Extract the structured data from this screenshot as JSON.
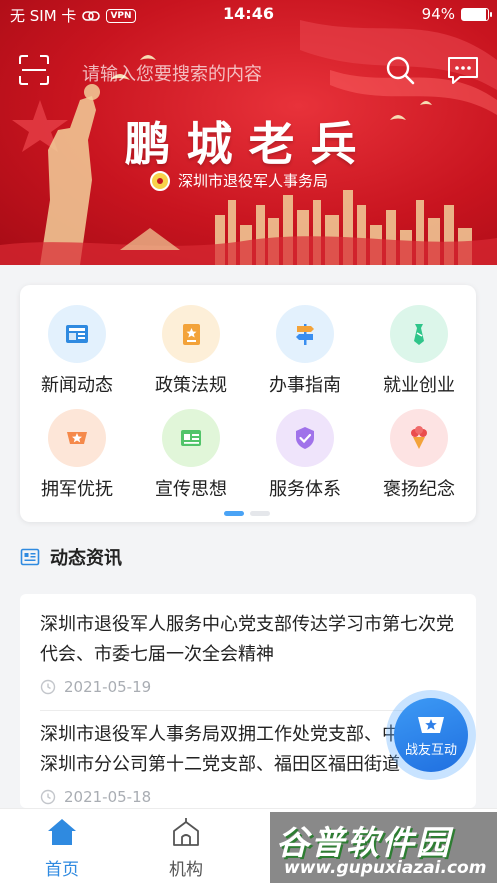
{
  "status_bar": {
    "carrier": "无 SIM 卡",
    "vpn": "VPN",
    "time": "14:46",
    "battery": "94%",
    "battery_level": 0.94
  },
  "header": {
    "search_placeholder": "请输入您要搜索的内容",
    "icons": [
      "scan-icon",
      "search-icon",
      "message-icon"
    ]
  },
  "banner": {
    "title": "鹏城老兵",
    "subtitle": "深圳市退役军人事务局"
  },
  "menu": {
    "items": [
      {
        "label": "新闻动态",
        "icon": "newspaper-icon",
        "bg": "#e3f1fd",
        "color": "#2f8ae0"
      },
      {
        "label": "政策法规",
        "icon": "policy-book-icon",
        "bg": "#fdefd8",
        "color": "#f3a33a"
      },
      {
        "label": "办事指南",
        "icon": "signpost-icon",
        "bg": "#e3f1fd",
        "color": "#3a8ef0"
      },
      {
        "label": "就业创业",
        "icon": "necktie-icon",
        "bg": "#dcf6ea",
        "color": "#2fc58a"
      },
      {
        "label": "拥军优抚",
        "icon": "star-badge-icon",
        "bg": "#fde6d8",
        "color": "#f5894a"
      },
      {
        "label": "宣传思想",
        "icon": "chart-board-icon",
        "bg": "#e1f6d9",
        "color": "#52c46a"
      },
      {
        "label": "服务体系",
        "icon": "shield-check-icon",
        "bg": "#efe4fb",
        "color": "#a072ea"
      },
      {
        "label": "褒扬纪念",
        "icon": "flower-bouquet-icon",
        "bg": "#fde3e3",
        "color": "#ea4d4d"
      }
    ],
    "pager_total": 2,
    "pager_active": 0
  },
  "news_section": {
    "title": "动态资讯",
    "items": [
      {
        "title": "深圳市退役军人服务中心党支部传达学习市第七次党代会、市委七届一次全会精神",
        "date": "2021-05-19"
      },
      {
        "title": "深圳市退役军人事务局双拥工作处党支部、中国人寿深圳市分公司第十二党支部、福田区福田街道",
        "date": "2021-05-18"
      }
    ]
  },
  "fab": {
    "label": "战友互动"
  },
  "tabbar": {
    "tabs": [
      {
        "label": "首页",
        "active": true
      },
      {
        "label": "机构",
        "active": false
      }
    ]
  },
  "watermark": {
    "title": "谷普软件园",
    "url": "www.gupuxiazai.com"
  },
  "colors": {
    "banner_red": "#c8141f",
    "accent_blue": "#2f8ae0",
    "tab_active": "#2f8ae0",
    "tab_inactive": "#555555"
  }
}
